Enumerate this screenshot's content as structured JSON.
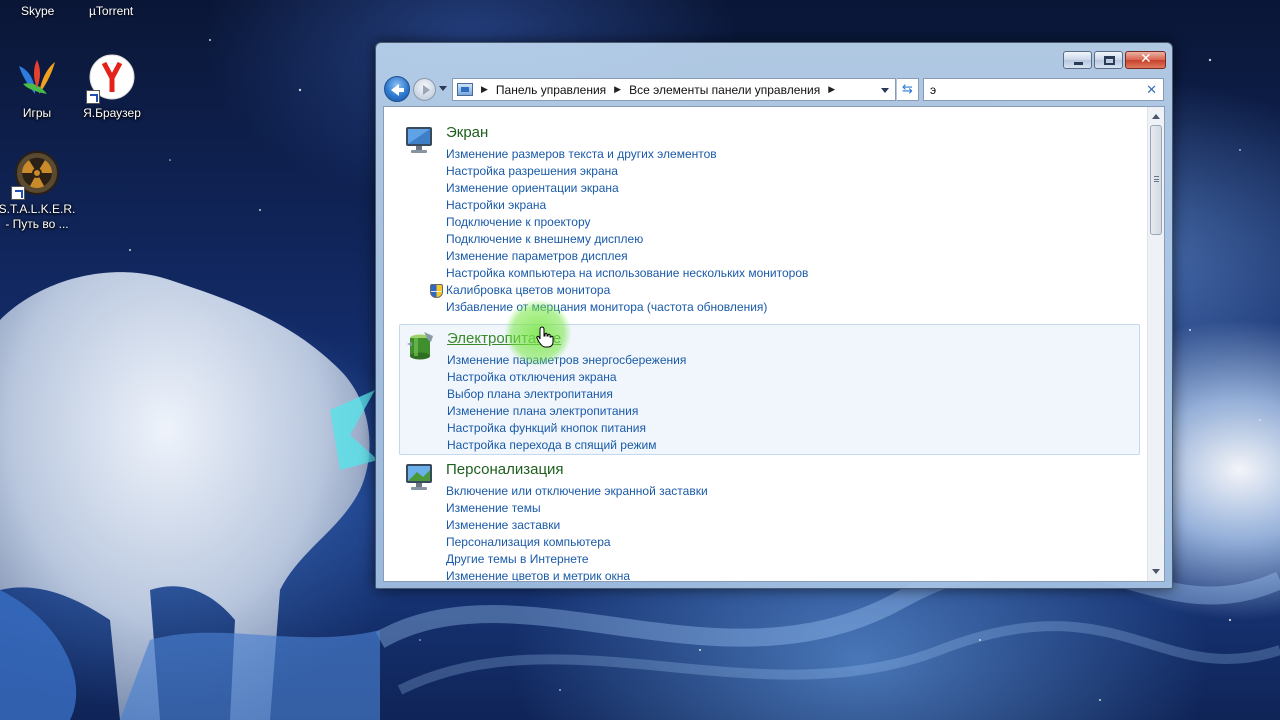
{
  "desktop": {
    "top_labels": [
      "Skype",
      "µTorrent"
    ],
    "icons": [
      {
        "label": "Игры"
      },
      {
        "label": "Я.Браузер"
      },
      {
        "label": "S.T.A.L.K.E.R. - Путь во ..."
      }
    ]
  },
  "window": {
    "address": {
      "crumbs": [
        "Панель управления",
        "Все элементы панели управления"
      ]
    },
    "search": {
      "value": "э"
    },
    "sections": [
      {
        "title": "Экран",
        "icon": "monitor-icon",
        "tasks": [
          "Изменение размеров текста и других элементов",
          "Настройка разрешения экрана",
          "Изменение ориентации экрана",
          "Настройки экрана",
          "Подключение к проектору",
          "Подключение к внешнему дисплею",
          "Изменение параметров дисплея",
          "Настройка компьютера на использование нескольких мониторов",
          "Калибровка цветов монитора",
          "Избавление от мерцания монитора (частота обновления)"
        ]
      },
      {
        "title": "Электропитание",
        "icon": "battery-icon",
        "tasks": [
          "Изменение параметров энергосбережения",
          "Настройка отключения экрана",
          "Выбор плана электропитания",
          "Изменение плана электропитания",
          "Настройка функций кнопок питания",
          "Настройка перехода в спящий режим"
        ]
      },
      {
        "title": "Персонализация",
        "icon": "personalization-icon",
        "tasks": [
          "Включение или отключение экранной заставки",
          "Изменение темы",
          "Изменение заставки",
          "Персонализация компьютера",
          "Другие темы в Интернете",
          "Изменение цветов и метрик окна"
        ]
      }
    ]
  }
}
